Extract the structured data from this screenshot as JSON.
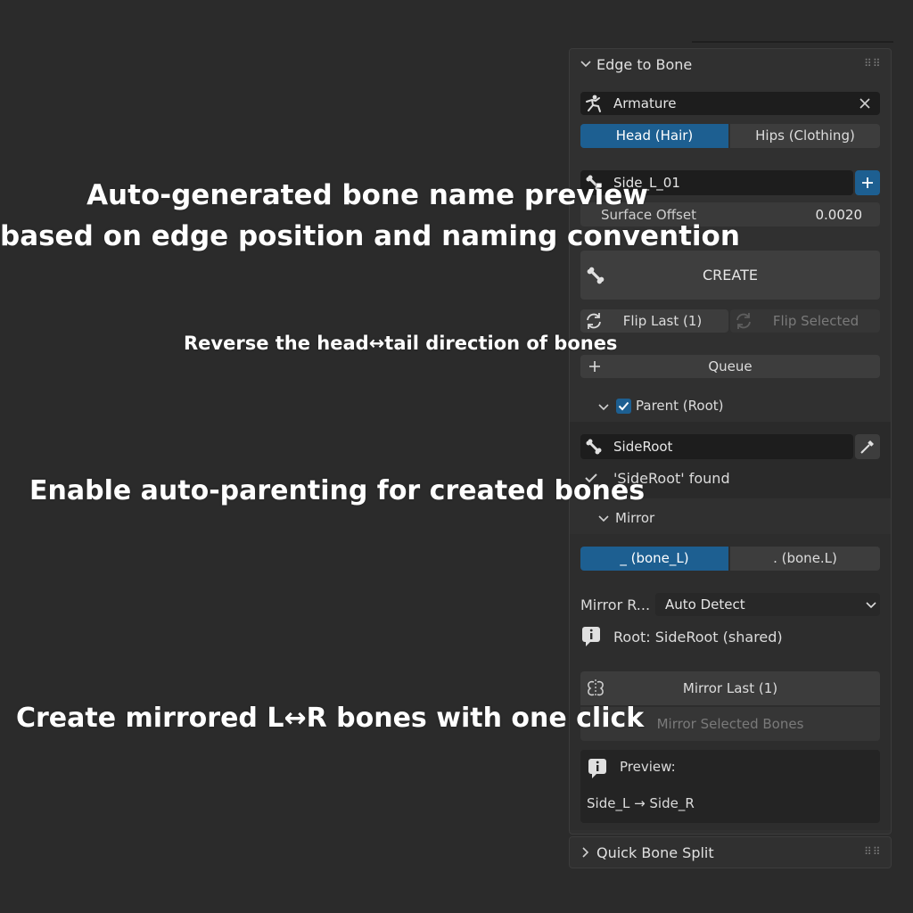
{
  "annotations": {
    "bone_name_line1": "Auto-generated bone name preview",
    "bone_name_line2": "based on edge position and naming convention",
    "flip": "Reverse the head↔tail direction of bones",
    "parenting": "Enable auto-parenting for created bones",
    "mirror": "Create mirrored L↔R bones with one click"
  },
  "panel": {
    "title": "Edge to Bone",
    "armature": "Armature",
    "mode_tabs": [
      "Head (Hair)",
      "Hips (Clothing)"
    ],
    "active_mode": "Head (Hair)",
    "bone_name": "Side_L_01",
    "surface_offset": {
      "label": "Surface Offset",
      "value": "0.0020"
    },
    "create_label": "CREATE",
    "flip_last_label": "Flip Last (1)",
    "flip_selected_label": "Flip Selected",
    "queue_label": "Queue",
    "parent": {
      "label": "Parent (Root)",
      "checked": true,
      "root_bone": "SideRoot",
      "status": "'SideRoot' found"
    },
    "mirror": {
      "label": "Mirror",
      "conventions": [
        "_ (bone_L)",
        ". (bone.L)"
      ],
      "active_convention": "_ (bone_L)",
      "mode_label": "Mirror R...",
      "mode_value": "Auto Detect",
      "root_info": "Root: SideRoot (shared)",
      "mirror_last_label": "Mirror Last (1)",
      "mirror_selected_label": "Mirror Selected Bones",
      "preview_label": "Preview:",
      "preview_value": "Side_L → Side_R"
    }
  },
  "quick_split": {
    "title": "Quick Bone Split"
  },
  "colors": {
    "accent": "#1d5f91",
    "panel": "#303030",
    "field": "#1d1d1d",
    "background": "#2b2b2b"
  },
  "icons": [
    "chevron-down-icon",
    "armature-icon",
    "close-icon",
    "bone-icon",
    "plus-icon",
    "refresh-icon",
    "checkmark-icon",
    "eyedropper-icon",
    "info-icon",
    "mirror-icon",
    "chevron-right-icon"
  ]
}
